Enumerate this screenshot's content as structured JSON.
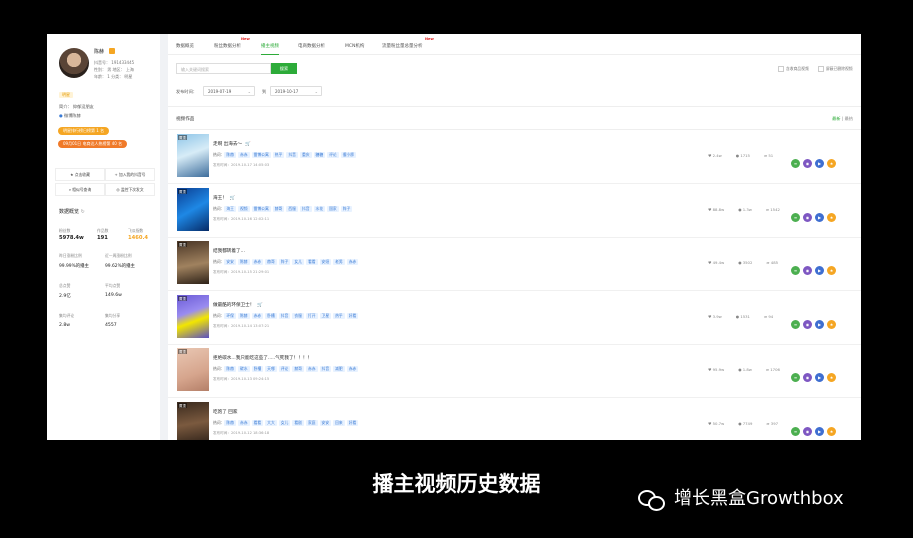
{
  "profile": {
    "name": "陈赫",
    "douyin_id": "抖音号： 191433445",
    "gender_region": "性别： 男   地区： 上海",
    "age_category": "年龄： 1   分类： 明星",
    "tag": "明星",
    "intro": "简介： 抑郁没朋友",
    "verified": "微博陈赫",
    "rank1": "明星排行榜日榜第 1 名",
    "rank2": "09月01日 电商达人热榜第 40 名",
    "actions": [
      "点击收藏",
      "加入我的抖音号",
      "相似号查询",
      "监控下次发文"
    ],
    "overview_title": "数据概览",
    "stats": [
      {
        "label": "粉丝数",
        "value": "5978.4w"
      },
      {
        "label": "作品数",
        "value": "191"
      },
      {
        "label": "飞瓜指数",
        "value": "1460.4"
      },
      {
        "label": "昨日涨粉比例",
        "value": "99.99%的播主"
      },
      {
        "label": "近一周涨粉比例",
        "value": "99.62%的播主"
      },
      {
        "label": "总点赞",
        "value": "2.9亿"
      },
      {
        "label": "平均点赞",
        "value": "149.6w"
      },
      {
        "label": "集均评论",
        "value": "2.8w"
      },
      {
        "label": "集均分享",
        "value": "4557"
      }
    ]
  },
  "tabs": [
    {
      "label": "数据概览",
      "new": false
    },
    {
      "label": "粉丝数据分析",
      "new": true
    },
    {
      "label": "播主视频",
      "new": false
    },
    {
      "label": "电商数据分析",
      "new": false
    },
    {
      "label": "MCN机构",
      "new": false
    },
    {
      "label": "流量粉丝量总量分析",
      "new": true
    }
  ],
  "new_label": "New",
  "search": {
    "placeholder": "输入关键词搜索",
    "button": "搜索"
  },
  "options": [
    "含收商品视频",
    "屏蔽已删除视频"
  ],
  "date": {
    "label": "发布时间：",
    "from": "2019-07-19",
    "to_label": "到",
    "to": "2019-10-17"
  },
  "list": {
    "title": "视频作品",
    "sort_new": "最新",
    "sort_hot": "最热"
  },
  "tag_prefix": "热词：",
  "time_prefix": "发布时间：",
  "videos": [
    {
      "pin": "置顶",
      "title": "走啊 出海去～",
      "cart": true,
      "tags": [
        "陈赫",
        "赤赤",
        "雷博公寓",
        "热乎",
        "抖音",
        "重庆",
        "糖糖",
        "评论",
        "傻小胖"
      ],
      "time": "2019-10-17 14:05:03",
      "likes": "2.4w",
      "comments": "1715",
      "shares": "51",
      "img": "a"
    },
    {
      "pin": "置顶",
      "title": "海王！",
      "cart": true,
      "tags": [
        "海王",
        "视频",
        "雷博公寓",
        "赫哥",
        "西服",
        "抖音",
        "水花",
        "国家",
        "阵子"
      ],
      "time": "2019-10-16 12:02:11",
      "likes": "88.8w",
      "comments": "1.3w",
      "shares": "1542",
      "img": "b"
    },
    {
      "pin": "置顶",
      "title": "结我都转着了...",
      "cart": false,
      "tags": [
        "安安",
        "陈赫",
        "赤赤",
        "赫哥",
        "阵子",
        "女儿",
        "看看",
        "安娅",
        "老男",
        "赤赤"
      ],
      "time": "2019-10-15 21:29:01",
      "likes": "49.4w",
      "comments": "3502",
      "shares": "485",
      "img": "c"
    },
    {
      "pin": "置顶",
      "title": "做最酷的环保卫士！",
      "cart": true,
      "tags": [
        "环保",
        "陈赫",
        "赤赤",
        "卧槽",
        "抖音",
        "衣服",
        "打开",
        "卫星",
        "热乎",
        "好看"
      ],
      "time": "2019-10-14 13:07:21",
      "likes": "3.9w",
      "comments": "1531",
      "shares": "94",
      "img": "d"
    },
    {
      "pin": "置顶",
      "title": "拒绝碳水...我只能吃这些了.....气死我了！！！！",
      "cart": false,
      "tags": [
        "陈赫",
        "碳水",
        "卧槽",
        "天哪",
        "评论",
        "赫哥",
        "赤赤",
        "抖音",
        "减肥",
        "赤赤"
      ],
      "time": "2019-10-13 09:24:15",
      "likes": "95.9w",
      "comments": "1.8w",
      "shares": "1706",
      "img": "e"
    },
    {
      "pin": "置顶",
      "title": "吃饱了 回家",
      "cart": false,
      "tags": [
        "陈赫",
        "赤赤",
        "看看",
        "大大",
        "女儿",
        "看剧",
        "家庭",
        "安安",
        "回来",
        "好看"
      ],
      "time": "2019-10-12 18:36:18",
      "likes": "50.7w",
      "comments": "7749",
      "shares": "397",
      "img": "f"
    }
  ],
  "caption": "播主视频历史数据",
  "watermark": "增长黑盒Growthbox"
}
